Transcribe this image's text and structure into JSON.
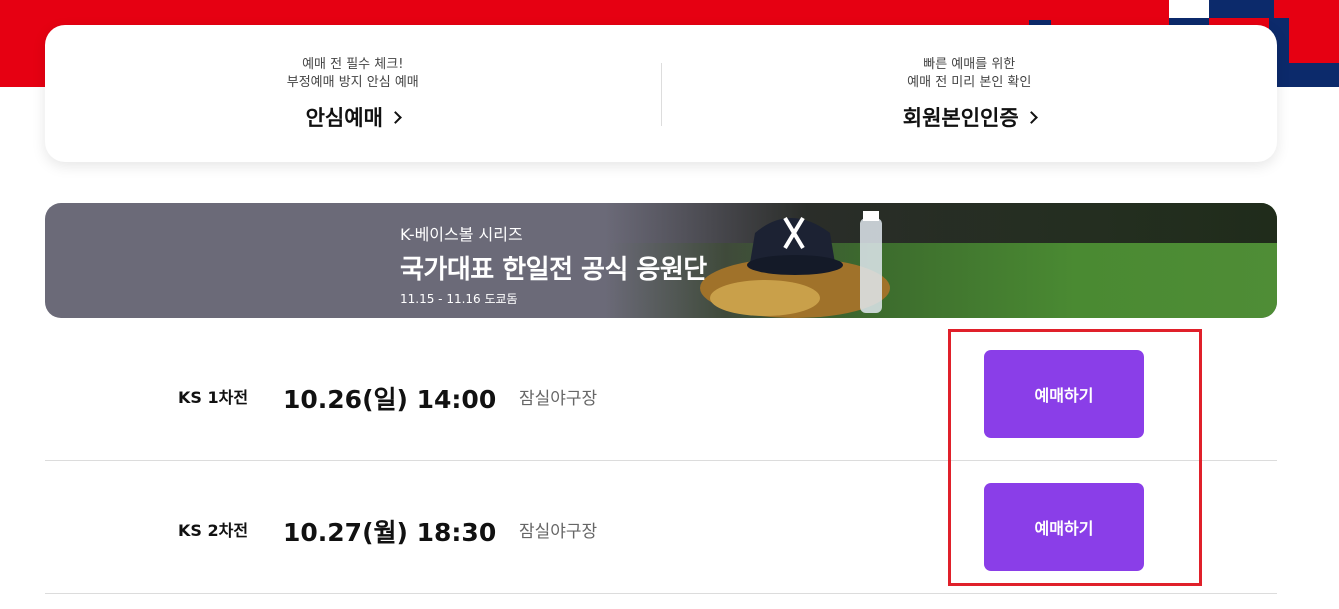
{
  "top_card": {
    "left": {
      "sub1": "예매 전 필수 체크!",
      "sub2": "부정예매 방지 안심 예매",
      "title": "안심예매"
    },
    "right": {
      "sub1": "빠른 예매를 위한",
      "sub2": "예매 전 미리 본인 확인",
      "title": "회원본인인증"
    }
  },
  "banner": {
    "kicker": "K-베이스볼 시리즈",
    "title": "국가대표 한일전 공식 응원단",
    "date": "11.15 - 11.16 도쿄돔"
  },
  "games": [
    {
      "round": "KS 1차전",
      "datetime": "10.26(일) 14:00",
      "venue": "잠실야구장",
      "button": "예매하기"
    },
    {
      "round": "KS 2차전",
      "datetime": "10.27(월) 18:30",
      "venue": "잠실야구장",
      "button": "예매하기"
    }
  ],
  "colors": {
    "brand_red": "#e60012",
    "button_purple": "#8a3ee8",
    "highlight_red": "#e0202a",
    "navy": "#0c2a6b"
  }
}
